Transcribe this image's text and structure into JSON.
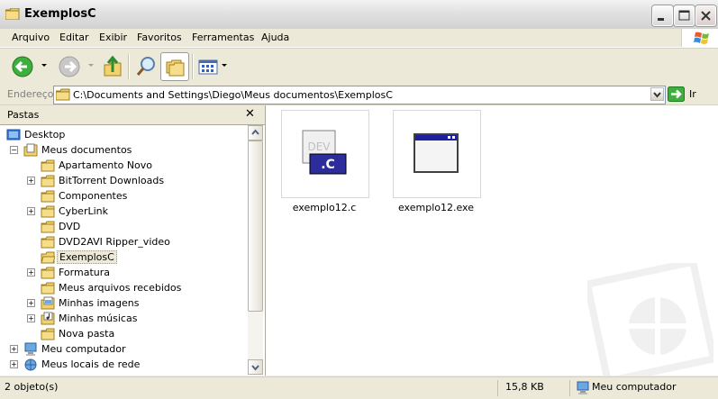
{
  "window": {
    "title": "ExemplosC"
  },
  "menu": [
    "Arquivo",
    "Editar",
    "Exibir",
    "Favoritos",
    "Ferramentas",
    "Ajuda"
  ],
  "address": {
    "label": "Endereço",
    "path": "C:\\Documents and Settings\\Diego\\Meus documentos\\ExemplosC",
    "go_label": "Ir"
  },
  "folders_pane": {
    "title": "Pastas",
    "tree": [
      {
        "label": "Desktop"
      },
      {
        "label": "Meus documentos"
      },
      {
        "label": "Apartamento Novo"
      },
      {
        "label": "BitTorrent Downloads"
      },
      {
        "label": "Componentes"
      },
      {
        "label": "CyberLink"
      },
      {
        "label": "DVD"
      },
      {
        "label": "DVD2AVI Ripper_video"
      },
      {
        "label": "ExemplosC"
      },
      {
        "label": "Formatura"
      },
      {
        "label": "Meus arquivos recebidos"
      },
      {
        "label": "Minhas imagens"
      },
      {
        "label": "Minhas músicas"
      },
      {
        "label": "Nova pasta"
      },
      {
        "label": "Meu computador"
      },
      {
        "label": "Meus locais de rede"
      }
    ]
  },
  "files": [
    {
      "name": "exemplo12.c",
      "badge": ".C"
    },
    {
      "name": "exemplo12.exe"
    }
  ],
  "status": {
    "objects": "2 objeto(s)",
    "size": "15,8 KB",
    "location": "Meu computador"
  },
  "colors": {
    "selection": "#316AC5",
    "address_border": "#7F9DB9",
    "file_badge": "#2C2C9C"
  }
}
